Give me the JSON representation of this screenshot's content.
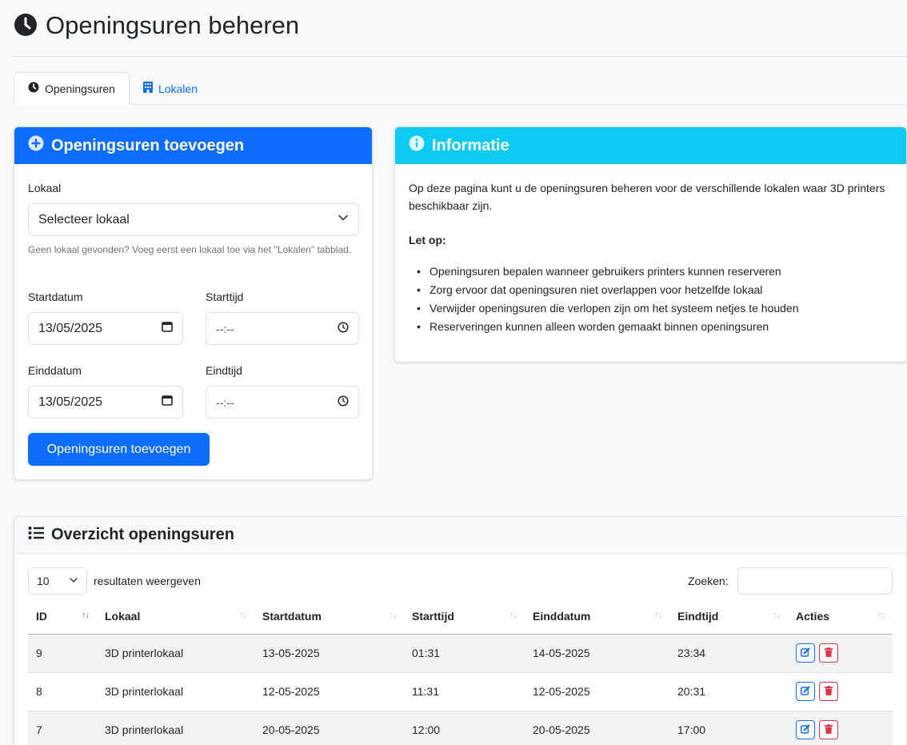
{
  "page": {
    "title": "Openingsuren beheren"
  },
  "tabs": [
    {
      "label": "Openingsuren",
      "icon": "clock-icon",
      "active": true
    },
    {
      "label": "Lokalen",
      "icon": "building-icon",
      "active": false
    }
  ],
  "add_form": {
    "title": "Openingsuren toevoegen",
    "lokaal_label": "Lokaal",
    "lokaal_value": "Selecteer lokaal",
    "lokaal_help": "Geen lokaal gevonden? Voeg eerst een lokaal toe via het \"Lokalen\" tabblad.",
    "startdatum_label": "Startdatum",
    "startdatum_value": "13/05/2025",
    "starttijd_label": "Starttijd",
    "starttijd_value": "--:--",
    "einddatum_label": "Einddatum",
    "einddatum_value": "13/05/2025",
    "eindtijd_label": "Eindtijd",
    "eindtijd_value": "--:--",
    "submit_label": "Openingsuren toevoegen"
  },
  "info": {
    "title": "Informatie",
    "intro": "Op deze pagina kunt u de openingsuren beheren voor de verschillende lokalen waar 3D printers beschikbaar zijn.",
    "note_title": "Let op:",
    "bullets": [
      "Openingsuren bepalen wanneer gebruikers printers kunnen reserveren",
      "Zorg ervoor dat openingsuren niet overlappen voor hetzelfde lokaal",
      "Verwijder openingsuren die verlopen zijn om het systeem netjes te houden",
      "Reserveringen kunnen alleen worden gemaakt binnen openingsuren"
    ]
  },
  "overview": {
    "title": "Overzicht openingsuren",
    "page_size": "10",
    "page_size_label": "resultaten weergeven",
    "search_label": "Zoeken:",
    "search_value": "",
    "columns": [
      "ID",
      "Lokaal",
      "Startdatum",
      "Starttijd",
      "Einddatum",
      "Eindtijd",
      "Acties"
    ],
    "rows": [
      {
        "id": "9",
        "lokaal": "3D printerlokaal",
        "startdatum": "13-05-2025",
        "starttijd": "01:31",
        "einddatum": "14-05-2025",
        "eindtijd": "23:34"
      },
      {
        "id": "8",
        "lokaal": "3D printerlokaal",
        "startdatum": "12-05-2025",
        "starttijd": "11:31",
        "einddatum": "12-05-2025",
        "eindtijd": "20:31"
      },
      {
        "id": "7",
        "lokaal": "3D printerlokaal",
        "startdatum": "20-05-2025",
        "starttijd": "12:00",
        "einddatum": "20-05-2025",
        "eindtijd": "17:00"
      }
    ]
  },
  "colors": {
    "primary": "#0d6efd",
    "info": "#0dcaf0",
    "danger": "#dc3545"
  }
}
